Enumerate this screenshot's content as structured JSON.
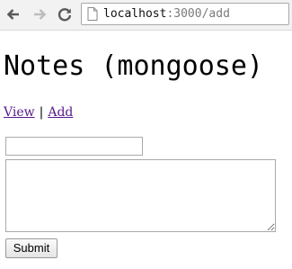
{
  "browser": {
    "back_icon": "arrow-left-icon",
    "forward_icon": "arrow-right-icon",
    "reload_icon": "reload-icon",
    "page_icon": "page-icon",
    "url_host": "localhost",
    "url_path": ":3000/add"
  },
  "page": {
    "title": "Notes (mongoose)",
    "nav": {
      "view_label": "View",
      "separator": "|",
      "add_label": "Add"
    },
    "form": {
      "title_value": "",
      "body_value": "",
      "submit_label": "Submit"
    }
  },
  "colors": {
    "link_visited": "#551a8b",
    "toolbar_bg": "#f2f2f2",
    "icon_active": "#5a5a5a",
    "icon_disabled": "#bdbdbd"
  }
}
